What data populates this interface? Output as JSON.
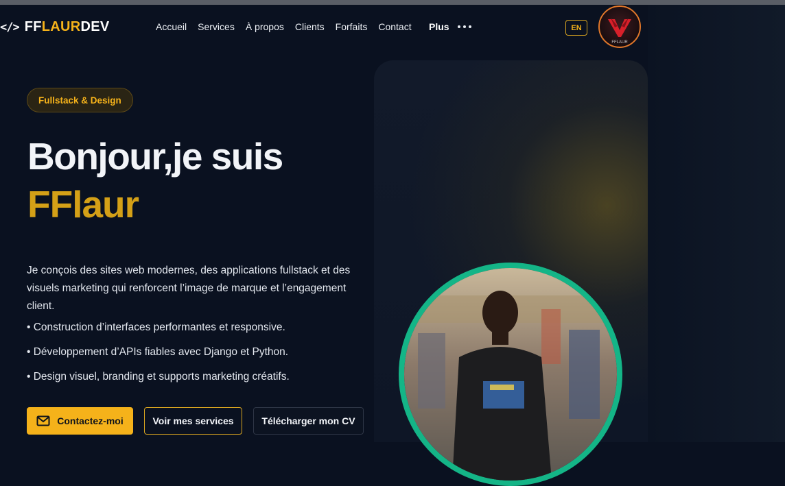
{
  "header": {
    "logo_icon": "</>",
    "logo_part1": "FF",
    "logo_part2": "LAUR",
    "logo_part3": "DEV",
    "nav": [
      "Accueil",
      "Services",
      "À propos",
      "Clients",
      "Forfaits",
      "Contact"
    ],
    "more_label": "Plus",
    "lang_label": "EN",
    "avatar_logo_text": "FFLAUR"
  },
  "hero": {
    "badge": "Fullstack & Design",
    "title_line1": "Bonjour,je suis",
    "title_line2": "FFlaur",
    "description": "Je conçois des sites web modernes, des applications fullstack et des visuels marketing qui renforcent l’image de marque et l’engagement client.",
    "bullets": [
      "• Construction d’interfaces performantes et responsive.",
      "• Développement d’APIs fiables avec Django et Python.",
      "• Design visuel, branding et supports marketing créatifs."
    ],
    "buttons": {
      "contact": "Contactez-moi",
      "services": "Voir mes services",
      "cv": "Télécharger mon CV"
    },
    "photo_icon": "profile-photo"
  },
  "colors": {
    "accent": "#f5b21a",
    "title_accent": "#d4a017",
    "background": "#0a1120",
    "photo_ring": "#14b587"
  }
}
